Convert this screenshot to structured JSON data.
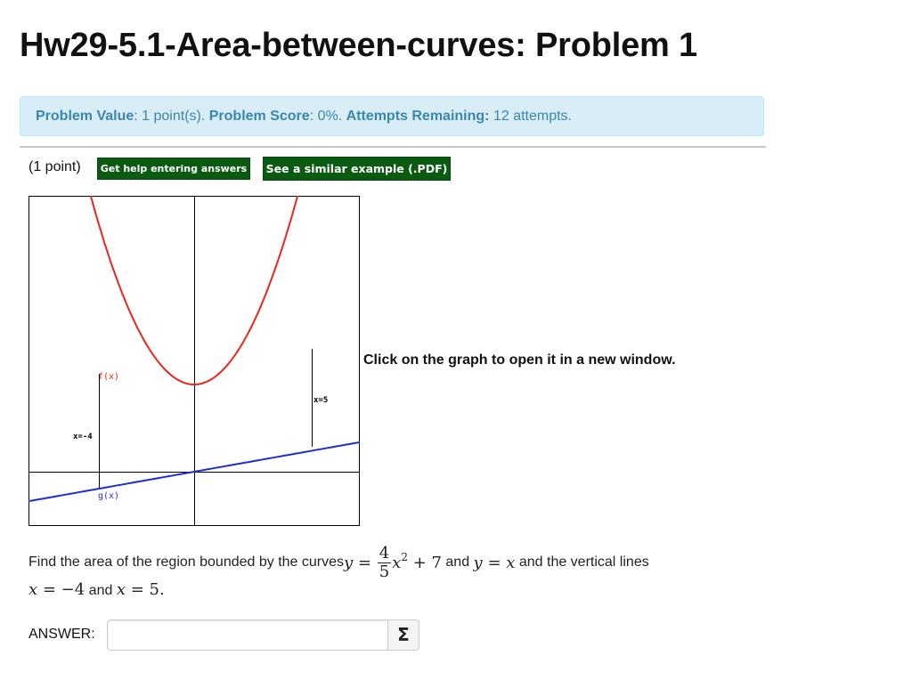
{
  "page": {
    "title": "Hw29-5.1-Area-between-curves: Problem 1"
  },
  "info": {
    "value_label": "Problem Value",
    "value_text": ": 1 point(s). ",
    "score_label": "Problem Score",
    "score_text": ": 0%. ",
    "attempts_label": "Attempts Remaining:",
    "attempts_text": " 12 attempts."
  },
  "problem": {
    "points_label": "(1 point)",
    "help_button": "Get help entering answers",
    "example_button": "See a similar example (.PDF)",
    "graph_caption": "Click on the graph to open it in a new window.",
    "text_intro": "Find the area of the region bounded by the curves ",
    "eq1_y": "y",
    "eq_equals": " = ",
    "frac_num": "4",
    "frac_den": "5",
    "eq1_x": "x",
    "eq1_exp": "2",
    "eq1_plus": " + 7",
    "and1": " and ",
    "eq2_y": "y",
    "eq2_x": "x",
    "text_lines": " and the vertical lines",
    "line_x1_var": "x",
    "line_x1_val": " = −4",
    "and2": " and ",
    "line_x2_var": "x",
    "line_x2_val": " = 5."
  },
  "answer": {
    "label": "ANSWER:",
    "value": "",
    "placeholder": "",
    "sigma_icon": "Σ"
  },
  "graph": {
    "colors": {
      "f_curve": "#e8261c",
      "g_curve": "#1f2ecf",
      "label_f": "#e8261c",
      "label_g": "#1f2ecf",
      "axes": "#000000"
    },
    "labels": {
      "f": "f(x)",
      "g": "g(x)",
      "left_line": "x=-4",
      "right_line": "x=5"
    }
  }
}
